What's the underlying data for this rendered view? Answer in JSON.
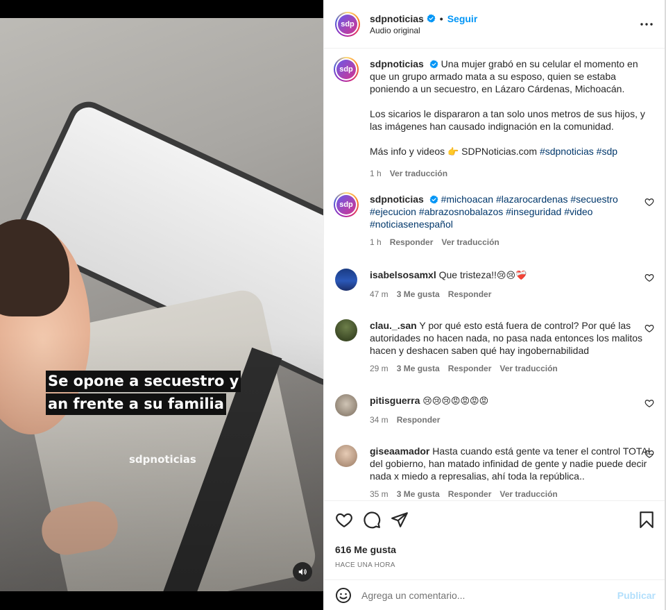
{
  "video": {
    "caption_line1": "Se opone a secuestro y",
    "caption_line2": "an frente a su familia",
    "watermark": "sdpnoticias"
  },
  "header": {
    "avatar_text": "sdp",
    "username": "sdpnoticias",
    "dot": "•",
    "follow_label": "Seguir",
    "audio": "Audio original"
  },
  "post": {
    "avatar_text": "sdp",
    "username": "sdpnoticias",
    "text1": "Una mujer grabó en su celular el momento en que un grupo armado mata a su esposo, quien se estaba poniendo a un secuestro, en Lázaro Cárdenas, Michoacán.",
    "text2": "Los sicarios le dispararon a tan solo unos metros de sus hijos, y las imágenes han causado indignación en la comunidad.",
    "text3_prefix": "Más info y videos",
    "text3_emoji": "👉",
    "text3_link": "SDPNoticias.com",
    "text3_tags": "#sdpnoticias #sdp",
    "time": "1 h",
    "translate": "Ver traducción"
  },
  "comments": [
    {
      "username": "sdpnoticias",
      "avatar_text": "sdp",
      "text": "#michoacan #lazarocardenas #secuestro #ejecucion #abrazosnobalazos #inseguridad #video #noticiasenespañol",
      "time": "1 h",
      "reply": "Responder",
      "translate": "Ver traducción"
    },
    {
      "username": "isabelsosamxl",
      "text": "Que tristeza!!",
      "emojis": "😢😢❤️‍🩹",
      "time": "47 m",
      "likes": "3 Me gusta",
      "reply": "Responder"
    },
    {
      "username": "clau._.san",
      "text": "Y por qué esto está fuera de control? Por qué las autoridades no hacen nada, no pasa nada entonces los malitos hacen y deshacen saben qué hay ingobernabilidad",
      "time": "29 m",
      "likes": "3 Me gusta",
      "reply": "Responder",
      "translate": "Ver traducción"
    },
    {
      "username": "pitisguerra",
      "emojis": "😢😢😢😡😡😡😡",
      "time": "34 m",
      "reply": "Responder"
    },
    {
      "username": "giseaamador",
      "text": "Hasta cuando está gente va tener el control TOTAL del gobierno, han matado infinidad de gente y nadie puede decir nada x miedo a represalias, ahí toda la república..",
      "time": "35 m",
      "likes": "3 Me gusta",
      "reply": "Responder",
      "translate": "Ver traducción"
    }
  ],
  "actions": {
    "likes": "616 Me gusta",
    "time": "HACE UNA HORA"
  },
  "add_comment": {
    "placeholder": "Agrega un comentario...",
    "publish": "Publicar"
  },
  "colors": {
    "follow": "#0095f6",
    "hashtag": "#00376b",
    "muted": "#737373",
    "publish_disabled": "#b2dffc"
  }
}
